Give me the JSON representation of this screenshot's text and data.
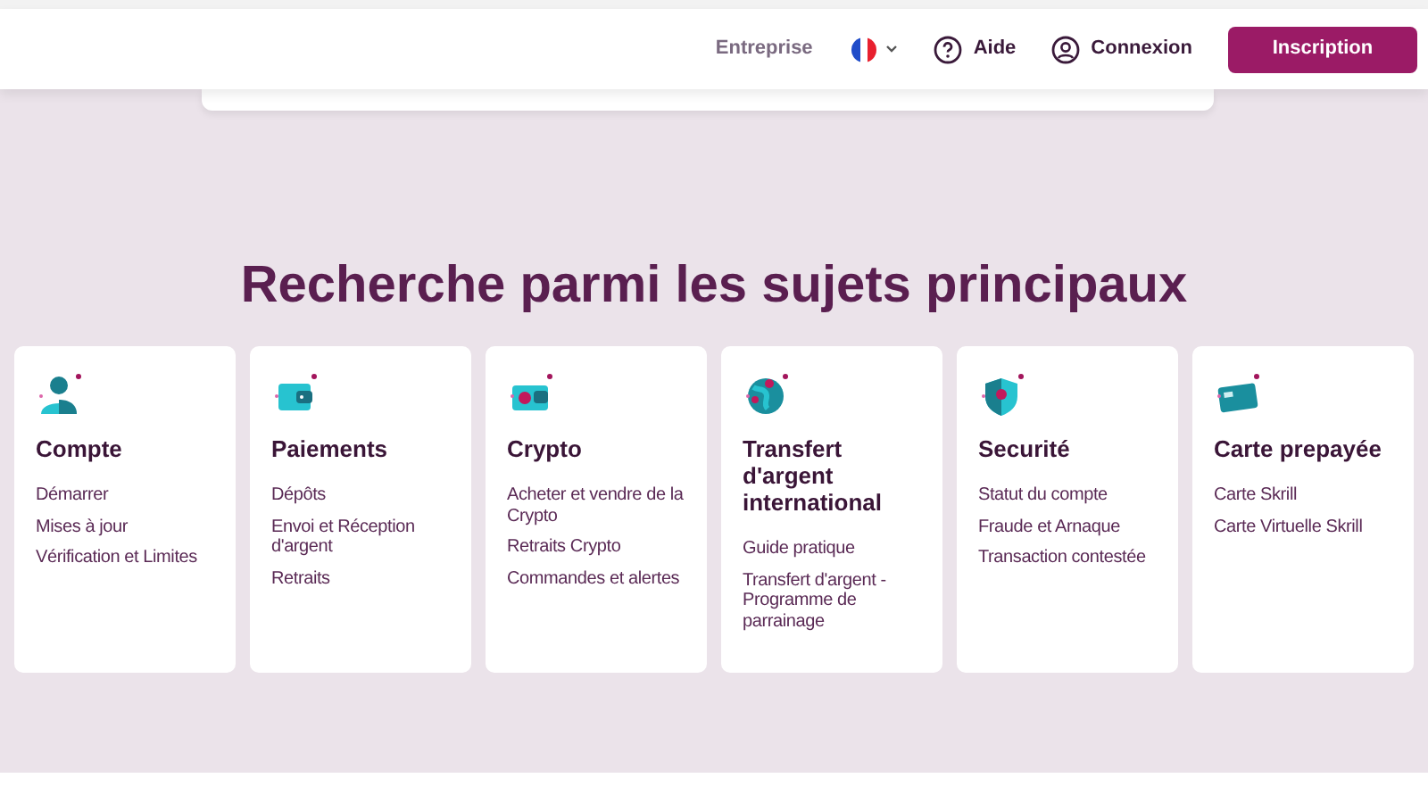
{
  "header": {
    "nav": [
      {
        "kind": "link",
        "label": "Entreprise"
      },
      {
        "kind": "language"
      },
      {
        "kind": "help",
        "label": "Aide"
      },
      {
        "kind": "login",
        "label": "Connexion"
      }
    ],
    "signup_button": "Inscription"
  },
  "title": "Recherche parmi les sujets principaux",
  "topics": [
    {
      "title": "Compte",
      "links": [
        "Démarrer",
        "Mises à jour",
        "Vérification et Limites"
      ]
    },
    {
      "title": "Paiements",
      "links": [
        "Dépôts",
        "Envoi et Réception d'argent",
        "Retraits"
      ]
    },
    {
      "title": "Crypto",
      "links": [
        "Acheter et vendre de la Crypto",
        "Retraits Crypto",
        "Commandes et alertes"
      ]
    },
    {
      "title": "Transfert d'argent international",
      "links": [
        "Guide pratique",
        "Transfert d'argent - Programme de parrainage"
      ]
    },
    {
      "title": "Securité",
      "links": [
        "Statut du compte",
        "Fraude et Arnaque",
        "Transaction contestée"
      ]
    },
    {
      "title": "Carte prepayée",
      "links": [
        "Carte Skrill",
        "Carte Virtuelle Skrill"
      ]
    }
  ]
}
